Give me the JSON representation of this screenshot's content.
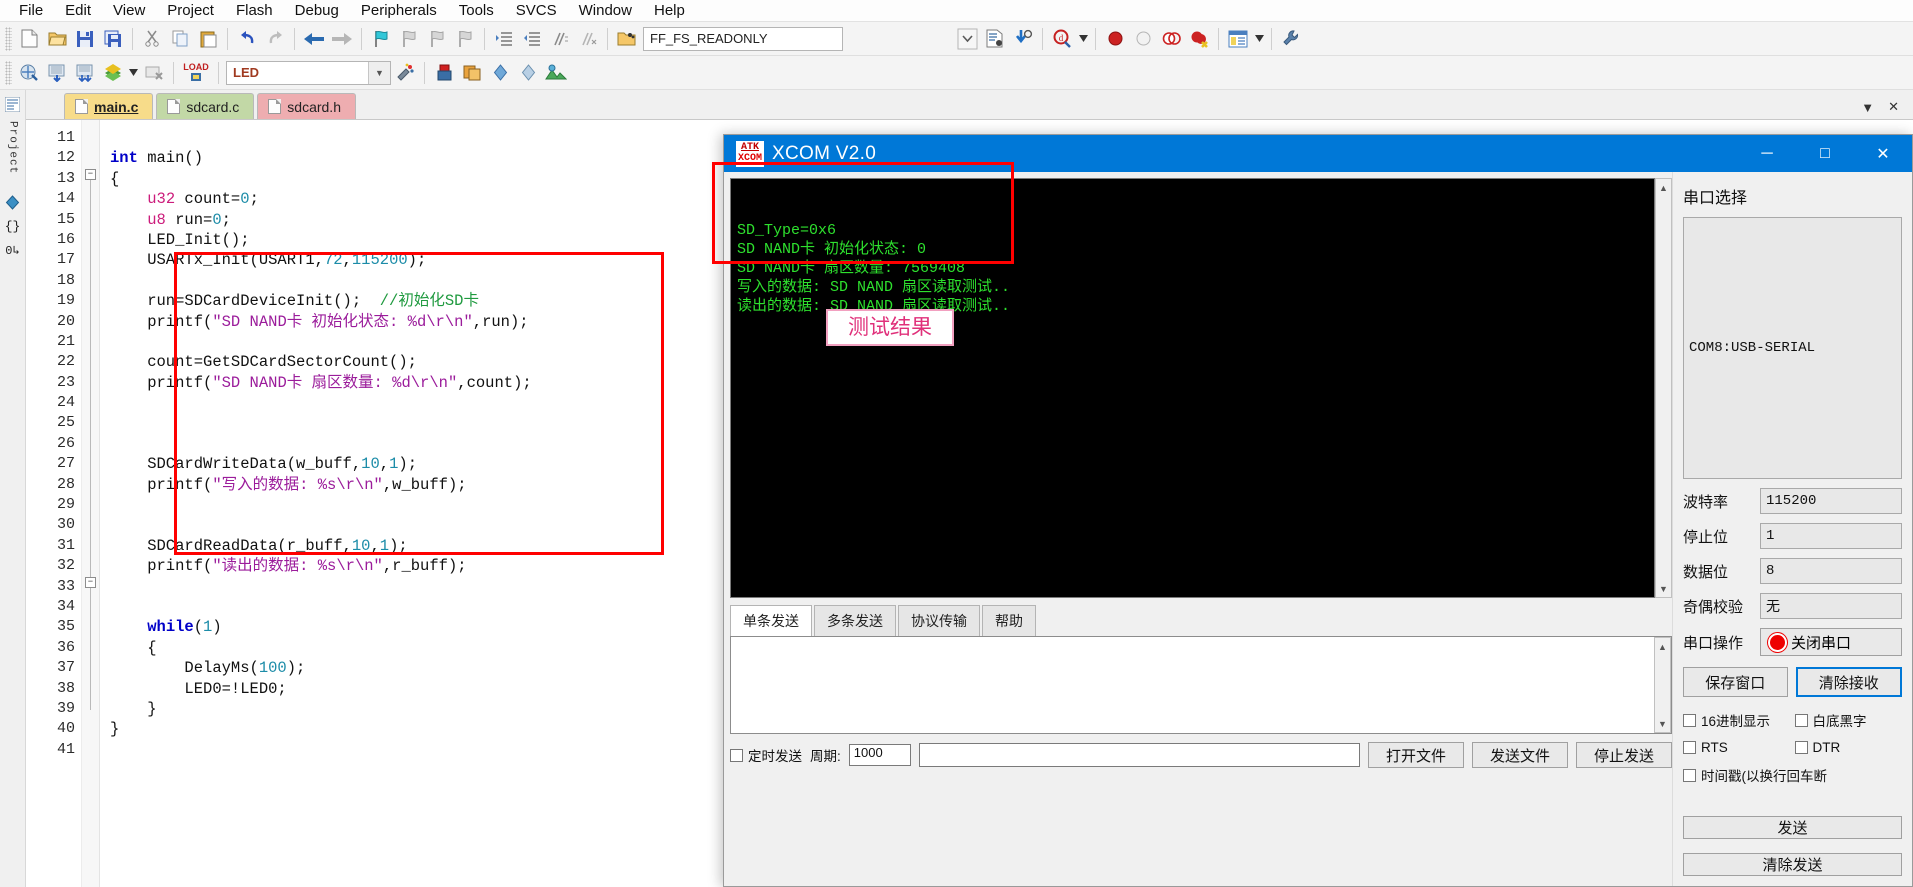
{
  "menubar": {
    "items": [
      {
        "label": "File"
      },
      {
        "label": "Edit"
      },
      {
        "label": "View"
      },
      {
        "label": "Project"
      },
      {
        "label": "Flash"
      },
      {
        "label": "Debug"
      },
      {
        "label": "Peripherals"
      },
      {
        "label": "Tools"
      },
      {
        "label": "SVCS"
      },
      {
        "label": "Window"
      },
      {
        "label": "Help"
      }
    ]
  },
  "toolbar1": {
    "combo_value": "FF_FS_READONLY",
    "icons": [
      {
        "name": "new-file-icon",
        "glyph": "⬜"
      },
      {
        "name": "open-file-icon",
        "glyph": "📂"
      },
      {
        "name": "save-icon",
        "glyph": "💾"
      },
      {
        "name": "save-all-icon",
        "glyph": "🖫"
      },
      {
        "name": "cut-icon",
        "glyph": "✂"
      },
      {
        "name": "copy-icon",
        "glyph": "⧉"
      },
      {
        "name": "paste-icon",
        "glyph": "📋"
      },
      {
        "name": "undo-icon",
        "glyph": "↶"
      },
      {
        "name": "redo-icon",
        "glyph": "↷"
      },
      {
        "name": "navigate-back-icon",
        "glyph": "←"
      },
      {
        "name": "navigate-forward-icon",
        "glyph": "→"
      },
      {
        "name": "bookmark-toggle-icon",
        "glyph": "⚑"
      },
      {
        "name": "bookmark-prev-icon",
        "glyph": "⚐"
      },
      {
        "name": "bookmark-next-icon",
        "glyph": "⚐"
      },
      {
        "name": "bookmark-clear-icon",
        "glyph": "⚐"
      },
      {
        "name": "indent-icon",
        "glyph": "≡"
      },
      {
        "name": "outdent-icon",
        "glyph": "≡"
      },
      {
        "name": "comment-icon",
        "glyph": "⫽"
      },
      {
        "name": "uncomment-icon",
        "glyph": "⫽"
      },
      {
        "name": "browse-open-icon",
        "glyph": "📂"
      }
    ],
    "after_combo_icons": [
      {
        "name": "text-document-icon",
        "glyph": "🗎"
      },
      {
        "name": "find-in-files-icon",
        "glyph": "🔍"
      },
      {
        "name": "debug-search-icon",
        "glyph": "ⓘ"
      },
      {
        "name": "breakpoint-insert-icon",
        "glyph": "●"
      },
      {
        "name": "breakpoint-disable-icon",
        "glyph": "○"
      },
      {
        "name": "breakpoint-disable-all-icon",
        "glyph": "◌"
      },
      {
        "name": "breakpoint-kill-all-icon",
        "glyph": "◉"
      },
      {
        "name": "window-layout-icon",
        "glyph": "☷"
      },
      {
        "name": "configure-wrench-icon",
        "glyph": "🔧"
      }
    ]
  },
  "toolbar2": {
    "target_value": "LED",
    "icons": [
      {
        "name": "translate-icon",
        "glyph": "⚙"
      },
      {
        "name": "build-icon",
        "glyph": "▦"
      },
      {
        "name": "rebuild-icon",
        "glyph": "▦"
      },
      {
        "name": "batch-build-icon",
        "glyph": "≣"
      },
      {
        "name": "stop-build-icon",
        "glyph": "▣"
      },
      {
        "name": "download-load-icon",
        "glyph": "LOAD"
      },
      {
        "name": "target-options-icon",
        "glyph": "⚒"
      },
      {
        "name": "manage-project-items-icon",
        "glyph": "▤"
      },
      {
        "name": "multi-project-icon",
        "glyph": "▥"
      },
      {
        "name": "pack-installer-icon",
        "glyph": "◇"
      },
      {
        "name": "run-to-cursor-icon",
        "glyph": "◈"
      },
      {
        "name": "manage-runtime-env-icon",
        "glyph": "⬟"
      }
    ]
  },
  "dockbar": {
    "items": [
      {
        "name": "project-window-icon",
        "glyph": "≡",
        "label": "Project"
      },
      {
        "name": "books-window-icon",
        "glyph": "◆",
        "label": ""
      },
      {
        "name": "functions-window-icon",
        "glyph": "{}",
        "label": ""
      },
      {
        "name": "templates-window-icon",
        "glyph": "0↵",
        "label": ""
      }
    ],
    "project_label": "Project"
  },
  "editor": {
    "tabs": [
      {
        "label": "main.c",
        "color": "yellow",
        "active": true
      },
      {
        "label": "sdcard.c",
        "color": "green",
        "active": false
      },
      {
        "label": "sdcard.h",
        "color": "pink",
        "active": false
      }
    ],
    "tab_controls": [
      {
        "name": "tab-list-dropdown",
        "glyph": "▼"
      },
      {
        "name": "tab-close-button",
        "glyph": "✕"
      }
    ],
    "first_line_number": 11,
    "lines": [
      {
        "n": 11,
        "html": ""
      },
      {
        "n": 12,
        "html": "<span class=\"kw\">int</span> main()"
      },
      {
        "n": 13,
        "html": "{"
      },
      {
        "n": 14,
        "html": "    <span class=\"typ\">u32</span> count=<span class=\"num\">0</span>;"
      },
      {
        "n": 15,
        "html": "    <span class=\"typ\">u8</span> run=<span class=\"num\">0</span>;"
      },
      {
        "n": 16,
        "html": "    LED_Init();"
      },
      {
        "n": 17,
        "html": "    USARTx_Init(USART1,<span class=\"num\">72</span>,<span class=\"num\">115200</span>);"
      },
      {
        "n": 18,
        "html": ""
      },
      {
        "n": 19,
        "html": "    run=SDCardDeviceInit();  <span class=\"cmt\">//初始化SD卡</span>"
      },
      {
        "n": 20,
        "html": "    printf(<span class=\"str\">\"SD NAND卡 初始化状态: %d\\r\\n\"</span>,run);"
      },
      {
        "n": 21,
        "html": ""
      },
      {
        "n": 22,
        "html": "    count=GetSDCardSectorCount();"
      },
      {
        "n": 23,
        "html": "    printf(<span class=\"str\">\"SD NAND卡 扇区数量: %d\\r\\n\"</span>,count);"
      },
      {
        "n": 24,
        "html": ""
      },
      {
        "n": 25,
        "html": ""
      },
      {
        "n": 26,
        "html": ""
      },
      {
        "n": 27,
        "html": "    SDCardWriteData(w_buff,<span class=\"num\">10</span>,<span class=\"num\">1</span>);"
      },
      {
        "n": 28,
        "html": "    printf(<span class=\"str\">\"写入的数据: %s\\r\\n\"</span>,w_buff);"
      },
      {
        "n": 29,
        "html": ""
      },
      {
        "n": 30,
        "html": ""
      },
      {
        "n": 31,
        "html": "    SDCardReadData(r_buff,<span class=\"num\">10</span>,<span class=\"num\">1</span>);"
      },
      {
        "n": 32,
        "html": "    printf(<span class=\"str\">\"读出的数据: %s\\r\\n\"</span>,r_buff);"
      },
      {
        "n": 33,
        "html": ""
      },
      {
        "n": 34,
        "html": ""
      },
      {
        "n": 35,
        "html": "    <span class=\"kw\">while</span>(<span class=\"num\">1</span>)"
      },
      {
        "n": 36,
        "html": "    {"
      },
      {
        "n": 37,
        "html": "        DelayMs(<span class=\"num\">100</span>);"
      },
      {
        "n": 38,
        "html": "        LED0=!LED0;"
      },
      {
        "n": 39,
        "html": "    }"
      },
      {
        "n": 40,
        "html": "}"
      },
      {
        "n": 41,
        "html": ""
      }
    ]
  },
  "xcom": {
    "title": "XCOM V2.0",
    "logo_line1": "ATK",
    "logo_line2": "XCOM",
    "window_buttons": [
      {
        "name": "minimize-button",
        "glyph": "─"
      },
      {
        "name": "maximize-button",
        "glyph": "□"
      },
      {
        "name": "close-button",
        "glyph": "✕"
      }
    ],
    "terminal_lines": [
      "SD_Type=0x6",
      "SD NAND卡 初始化状态: 0",
      "SD NAND卡 扇区数量: 7569408",
      "写入的数据: SD NAND 扇区读取测试..",
      "读出的数据: SD NAND 扇区读取测试.."
    ],
    "result_badge": "测试结果",
    "send_tabs": [
      {
        "label": "单条发送",
        "active": true
      },
      {
        "label": "多条发送",
        "active": false
      },
      {
        "label": "协议传输",
        "active": false
      },
      {
        "label": "帮助",
        "active": false
      }
    ],
    "send_input_value": "",
    "bottom": {
      "timed_send_label": "定时发送",
      "period_label": "周期:",
      "period_value": "1000",
      "file_path_value": "",
      "open_file_button": "打开文件",
      "send_file_button": "发送文件",
      "stop_send_button": "停止发送"
    },
    "settings": {
      "section_title": "串口选择",
      "port_value": "COM8:USB-SERIAL",
      "fields": [
        {
          "label": "波特率",
          "value": "115200"
        },
        {
          "label": "停止位",
          "value": "1"
        },
        {
          "label": "数据位",
          "value": "8"
        },
        {
          "label": "奇偶校验",
          "value": "无"
        }
      ],
      "operation_label": "串口操作",
      "operation_button": "关闭串口",
      "save_window_button": "保存窗口",
      "clear_receive_button": "清除接收",
      "checkboxes": [
        {
          "label": "16进制显示",
          "checked": false
        },
        {
          "label": "白底黑字",
          "checked": false
        },
        {
          "label": "RTS",
          "checked": false
        },
        {
          "label": "DTR",
          "checked": false
        },
        {
          "label": "时间戳(以换行回车断",
          "checked": false
        }
      ],
      "send_button": "发送",
      "clear_send_button": "清除发送"
    }
  },
  "colors": {
    "accent": "#0078d7",
    "highlight_red": "#ff0000",
    "terminal_green": "#2ee02e",
    "badge_pink": "#e0307a"
  }
}
